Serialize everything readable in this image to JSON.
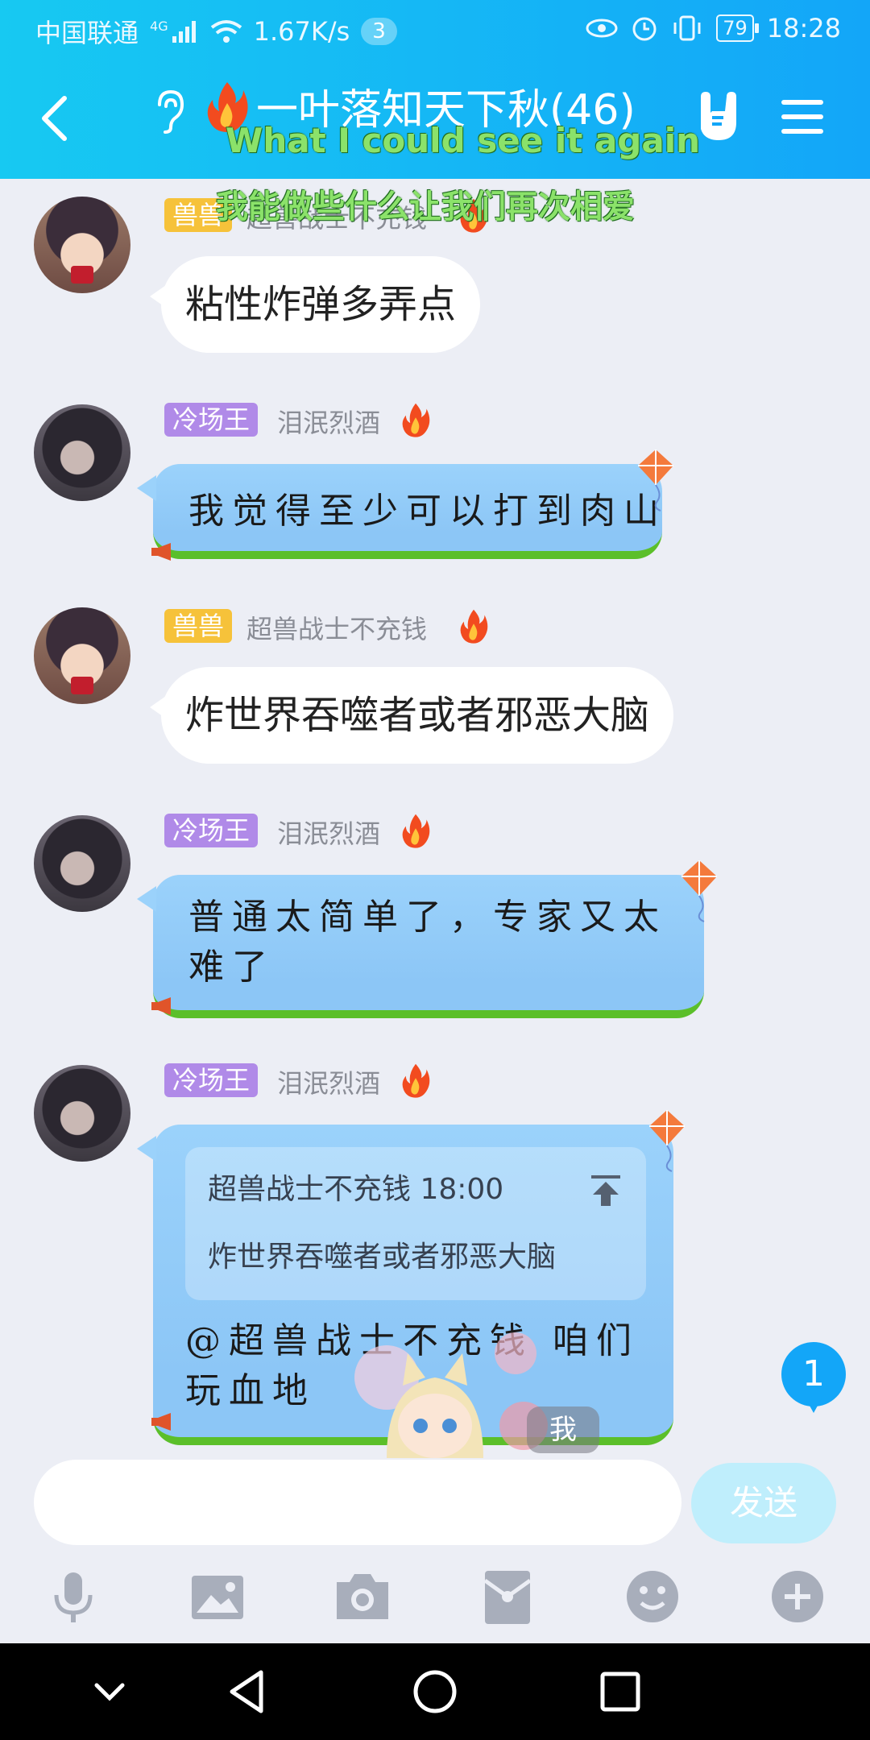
{
  "status_bar": {
    "carrier": "中国联通",
    "network": "4G",
    "speed": "1.67K/s",
    "notification_count": "3",
    "battery": "79",
    "time": "18:28"
  },
  "header": {
    "title": "一叶落知天下秋(46)",
    "lyric_en": "What I could see it again",
    "lyric_zh": "我能做些什么让我们再次相爱"
  },
  "messages": [
    {
      "tag": "兽兽",
      "nick": "超兽战士不充钱",
      "text": "粘性炸弹多弄点"
    },
    {
      "tag": "冷场王",
      "nick": "泪泯烈酒",
      "text": "我觉得至少可以打到肉山"
    },
    {
      "tag": "兽兽",
      "nick": "超兽战士不充钱",
      "text": "炸世界吞噬者或者邪恶大脑"
    },
    {
      "tag": "冷场王",
      "nick": "泪泯烈酒",
      "text": "普通太简单了，专家又太难了"
    },
    {
      "tag": "冷场王",
      "nick": "泪泯烈酒",
      "quote_header": "超兽战士不充钱 18:00",
      "quote_text": "炸世界吞噬者或者邪恶大脑",
      "text": "@超兽战士不充钱 咱们玩血地"
    }
  ],
  "unread_badge": "1",
  "sticker_label": "我",
  "input": {
    "placeholder": "",
    "send_label": "发送"
  },
  "toolbar_icons": [
    "microphone-icon",
    "image-icon",
    "camera-icon",
    "red-packet-icon",
    "emoji-icon",
    "plus-icon"
  ],
  "colors": {
    "header_start": "#17c9f2",
    "header_end": "#13a6f8",
    "bubble_blue": "#9bd2fb",
    "tag_yellow": "#f6c23a",
    "tag_purple": "#b08ae8"
  }
}
